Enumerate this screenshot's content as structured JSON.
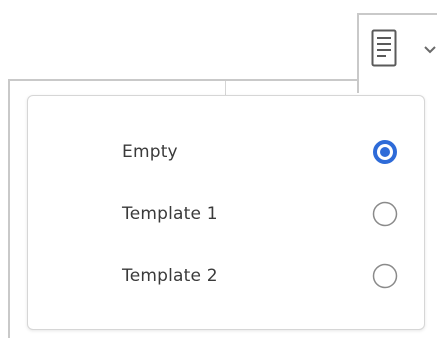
{
  "toolbar": {
    "template_button": {
      "icon": "document-icon",
      "dropdown_icon": "chevron-down-icon"
    }
  },
  "menu": {
    "options": [
      {
        "label": "Empty",
        "selected": true
      },
      {
        "label": "Template 1",
        "selected": false
      },
      {
        "label": "Template 2",
        "selected": false
      }
    ]
  },
  "colors": {
    "radio_selected": "#2e6bd8",
    "radio_unselected": "#8a8a8a",
    "text": "#3a3a3a",
    "border": "#c9c9c9"
  }
}
